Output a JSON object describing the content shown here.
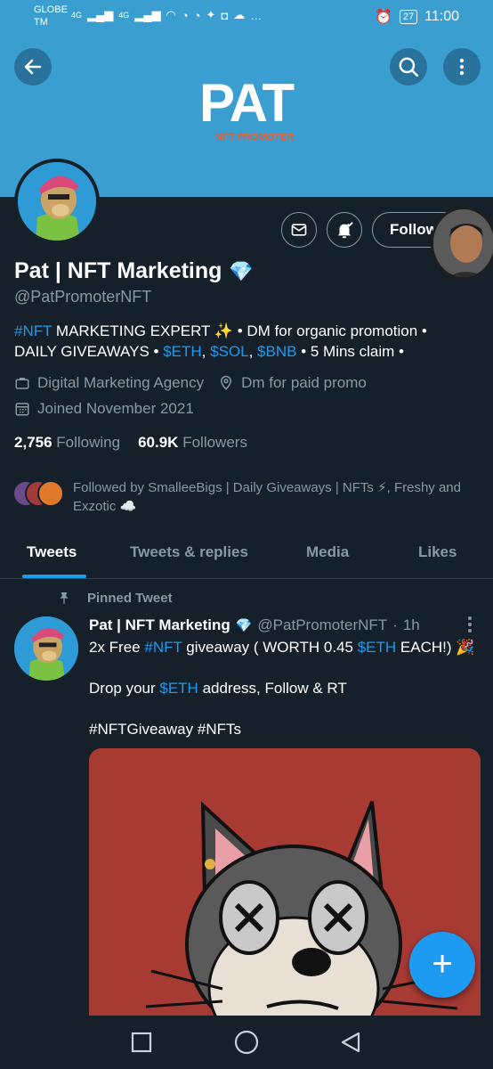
{
  "status_bar": {
    "carrier_line1": "GLOBE",
    "carrier_line2": "TM",
    "network": "4G",
    "battery": "27",
    "time": "11:00"
  },
  "banner": {
    "logo_text": "PAT",
    "logo_subtitle": "NFT PROMOTER",
    "back_icon": "arrow-left-icon",
    "search_icon": "search-icon",
    "more_icon": "more-vertical-icon",
    "background_color": "#3a9fd0"
  },
  "profile": {
    "name": "Pat | NFT Marketing",
    "verified_emoji": "💎",
    "handle": "@PatPromoterNFT",
    "bio_line1": {
      "hashtag": "#NFT",
      "text": " MARKETING EXPERT ✨ • DM for organic promotion •"
    },
    "bio_line2": {
      "prefix": "DAILY GIVEAWAYS • ",
      "eth": "$ETH",
      "comma1": ", ",
      "sol": "$SOL",
      "comma2": ", ",
      "bnb": "$BNB",
      "suffix": " • 5 Mins claim •"
    },
    "category": "Digital Marketing Agency",
    "location": "Dm for paid promo",
    "joined": "Joined November 2021",
    "following_count": "2,756",
    "following_label": "Following",
    "followers_count": "60.9K",
    "followers_label": "Followers",
    "followed_by": "Followed by SmalleeBigs | Daily Giveaways | NFTs ⚡, Freshy and Exzotic ☁️",
    "follow_button": "Follow"
  },
  "tabs": [
    "Tweets",
    "Tweets & replies",
    "Media",
    "Likes"
  ],
  "tweet": {
    "pinned_label": "Pinned Tweet",
    "author_name": "Pat | NFT Marketing",
    "author_handle": "@PatPromoterNFT",
    "dot": "·",
    "time": "1h",
    "line1": {
      "a": "2x Free ",
      "hashtag": "#NFT",
      "b": " giveaway ( WORTH 0.45 ",
      "eth": "$ETH",
      "c": " EACH!) 🎉"
    },
    "line2": {
      "a": "Drop your ",
      "eth": "$ETH",
      "b": " address, Follow & RT"
    },
    "line3": "#NFTGiveaway #NFTs"
  },
  "fab": {
    "icon": "plus-icon",
    "label": "+"
  },
  "colors": {
    "background": "#15202b",
    "accent": "#1d9bf0",
    "muted": "#8899a6",
    "media_background": "#a83a34"
  }
}
